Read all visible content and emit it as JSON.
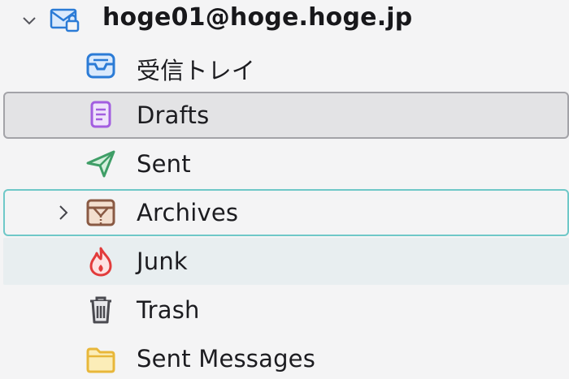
{
  "account": {
    "name": "hoge01@hoge.hoge.jp",
    "expanded": true,
    "icon": "mail-account-icon"
  },
  "folders": [
    {
      "label": "受信トレイ",
      "icon": "inbox-icon",
      "color": "#2b7bd6"
    },
    {
      "label": "Drafts",
      "icon": "drafts-icon",
      "color": "#a35ee0",
      "state": "selected"
    },
    {
      "label": "Sent",
      "icon": "sent-icon",
      "color": "#3f9e67"
    },
    {
      "label": "Archives",
      "icon": "archives-icon",
      "color": "#8a5a44",
      "collapsed": true,
      "state": "focused"
    },
    {
      "label": "Junk",
      "icon": "junk-icon",
      "color": "#e23b3b",
      "state": "hover"
    },
    {
      "label": "Trash",
      "icon": "trash-icon",
      "color": "#4a4a50"
    },
    {
      "label": "Sent Messages",
      "icon": "folder-icon",
      "color": "#e8b73a"
    }
  ]
}
